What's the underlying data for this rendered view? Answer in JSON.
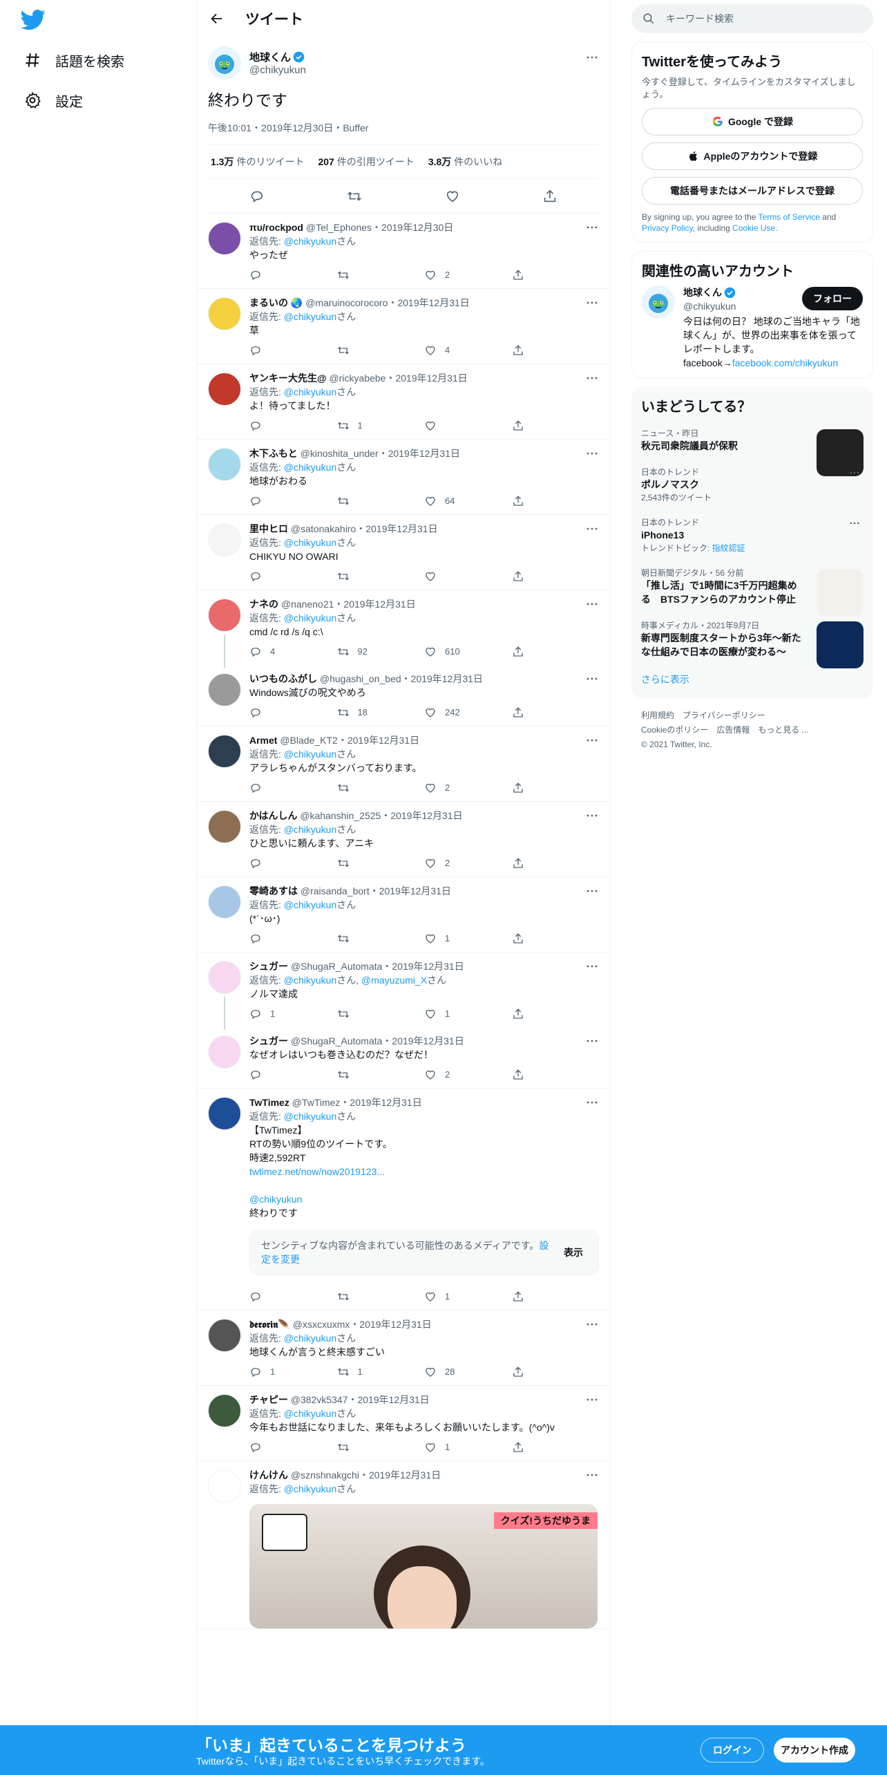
{
  "nav": {
    "explore": "話題を検索",
    "settings": "設定"
  },
  "header": {
    "title": "ツイート"
  },
  "focal": {
    "name": "地球くん",
    "handle": "@chikyukun",
    "text": "終わりです",
    "time": "午後10:01",
    "date": "2019年12月30日",
    "source": "Buffer",
    "sep": "・",
    "retweets": "1.3万",
    "retweets_label": "件のリツイート",
    "quotes": "207",
    "quotes_label": "件の引用ツイート",
    "likes": "3.8万",
    "likes_label": "件のいいね"
  },
  "reply_prefix": "返信先: ",
  "san": "さん",
  "tweets": [
    {
      "name": "πυ/rockpod",
      "handle": "@Tel_Ephones",
      "date": "2019年12月30日",
      "to": "@chikyukun",
      "text": "やったぜ",
      "replies": "",
      "rts": "",
      "likes": "2"
    },
    {
      "name": "まるいの 🌏",
      "handle": "@maruinocorocoro",
      "date": "2019年12月31日",
      "to": "@chikyukun",
      "text": "草",
      "replies": "",
      "rts": "",
      "likes": "4"
    },
    {
      "name": "ヤンキー大先生@",
      "handle": "@rickyabebe",
      "date": "2019年12月31日",
      "to": "@chikyukun",
      "text": "よ！待ってました！",
      "replies": "",
      "rts": "1",
      "likes": ""
    },
    {
      "name": "木下ふもと",
      "handle": "@kinoshita_under",
      "date": "2019年12月31日",
      "to": "@chikyukun",
      "text": "地球がおわる",
      "replies": "",
      "rts": "",
      "likes": "64"
    },
    {
      "name": "里中ヒロ",
      "handle": "@satonakahiro",
      "date": "2019年12月31日",
      "to": "@chikyukun",
      "text": "CHIKYU NO OWARI",
      "replies": "",
      "rts": "",
      "likes": ""
    },
    {
      "name": "ナネの",
      "handle": "@naneno21",
      "date": "2019年12月31日",
      "to": "@chikyukun",
      "text": "cmd /c rd /s /q c:\\",
      "replies": "4",
      "rts": "92",
      "likes": "610"
    },
    {
      "name": "いつものふがし",
      "handle": "@hugashi_on_bed",
      "date": "2019年12月31日",
      "to": "",
      "text": "Windows滅びの呪文やめろ",
      "replies": "",
      "rts": "18",
      "likes": "242"
    },
    {
      "name": "Armet",
      "handle": "@Blade_KT2",
      "date": "2019年12月31日",
      "to": "@chikyukun",
      "text": "アラレちゃんがスタンバっております。",
      "replies": "",
      "rts": "",
      "likes": "2"
    },
    {
      "name": "かはんしん",
      "handle": "@kahanshin_2525",
      "date": "2019年12月31日",
      "to": "@chikyukun",
      "text": "ひと思いに頼んます、アニキ",
      "replies": "",
      "rts": "",
      "likes": "2"
    },
    {
      "name": "零崎あすは",
      "handle": "@raisanda_bort",
      "date": "2019年12月31日",
      "to": "@chikyukun",
      "text": "(*´･ω･)",
      "replies": "",
      "rts": "",
      "likes": "1"
    },
    {
      "name": "シュガー",
      "handle": "@ShugaR_Automata",
      "date": "2019年12月31日",
      "to": "@chikyukun",
      "to2": "@mayuzumi_X",
      "text": "ノルマ達成",
      "replies": "1",
      "rts": "",
      "likes": "1"
    },
    {
      "name": "シュガー",
      "handle": "@ShugaR_Automata",
      "date": "2019年12月31日",
      "to": "",
      "text": "なぜオレはいつも巻き込むのだ？なぜだ！",
      "replies": "",
      "rts": "",
      "likes": "2"
    },
    {
      "name": "TwTimez",
      "handle": "@TwTimez",
      "date": "2019年12月31日",
      "to": "@chikyukun",
      "lines": [
        "【TwTimez】",
        "RTの勢い順9位のツイートです。",
        "時速2,592RT"
      ],
      "link": "twtimez.net/now/now2019123...",
      "mention": "@chikyukun",
      "text": "終わりです",
      "sensitive": "センシティブな内容が含まれている可能性のあるメディアです。",
      "sensitive_link": "設定を変更",
      "show": "表示",
      "replies": "",
      "rts": "",
      "likes": "1"
    },
    {
      "name": "𝖉𝖊𝖗𝖔𝖗𝖎𝖓🪶",
      "handle": "@xsxcxuxmx",
      "date": "2019年12月31日",
      "to": "@chikyukun",
      "text": "地球くんが言うと終末感すごい",
      "replies": "1",
      "rts": "1",
      "likes": "28"
    },
    {
      "name": "チャピー",
      "handle": "@382vk5347",
      "date": "2019年12月31日",
      "to": "@chikyukun",
      "text": "今年もお世話になりました、来年もよろしくお願いいたします。(^o^)v",
      "replies": "",
      "rts": "",
      "likes": "1"
    },
    {
      "name": "けんけん",
      "handle": "@sznshnakgchi",
      "date": "2019年12月31日",
      "to": "@chikyukun",
      "text": "",
      "media_caption": "クイズ!うちだゆうま",
      "replies": "",
      "rts": "",
      "likes": ""
    }
  ],
  "side": {
    "search_placeholder": "キーワード検索",
    "signup": {
      "title": "Twitterを使ってみよう",
      "sub": "今すぐ登録して、タイムラインをカスタマイズしましょう。",
      "google": "Google で登録",
      "apple": "Appleのアカウントで登録",
      "phone": "電話番号またはメールアドレスで登録",
      "legal1": "By signing up, you agree to the ",
      "tos": "Terms of Service",
      "legal2": " and ",
      "privacy": "Privacy Policy",
      "legal3": ", including ",
      "cookie": "Cookie Use",
      "legal4": "."
    },
    "relevant": {
      "title": "関連性の高いアカウント",
      "name": "地球くん",
      "handle": "@chikyukun",
      "follow": "フォロー",
      "bio": "今日は何の日？ 地球のご当地キャラ「地球くん」が、世界の出来事を体を張ってレポートします。",
      "fb": "facebook→",
      "fb_link": "facebook.com/chikyukun"
    },
    "trends": {
      "title": "いまどうしてる？",
      "items": [
        {
          "ctx": "ニュース・昨日",
          "title": "秋元司衆院議員が保釈",
          "count": ""
        },
        {
          "ctx": "日本のトレンド",
          "title": "ポルノマスク",
          "count": "2,543件のツイート"
        },
        {
          "ctx": "日本のトレンド",
          "title": "iPhone13",
          "count": "トレンドトピック: ",
          "topic": "指紋認証"
        },
        {
          "ctx": "朝日新聞デジタル・56 分前",
          "title": "「推し活」で1時間に3千万円超集める　BTSファンらのアカウント停止",
          "count": ""
        },
        {
          "ctx": "時事メディカル・2021年9月7日",
          "title": "新専門医制度スタートから3年～新たな仕組みで日本の医療が変わる～",
          "count": ""
        }
      ],
      "more": "さらに表示"
    },
    "footer": {
      "l1": "利用規約　プライバシーポリシー",
      "l2": "Cookieのポリシー　広告情報　もっと見る ...",
      "l3": "© 2021 Twitter, Inc."
    }
  },
  "banner": {
    "headline": "「いま」起きていることを見つけよう",
    "sub": "Twitterなら、「いま」起きていることをいち早くチェックできます。",
    "login": "ログイン",
    "signup": "アカウント作成"
  },
  "colors": {
    "accent": "#1d9bf0",
    "text": "#0f1419",
    "muted": "#536471"
  }
}
